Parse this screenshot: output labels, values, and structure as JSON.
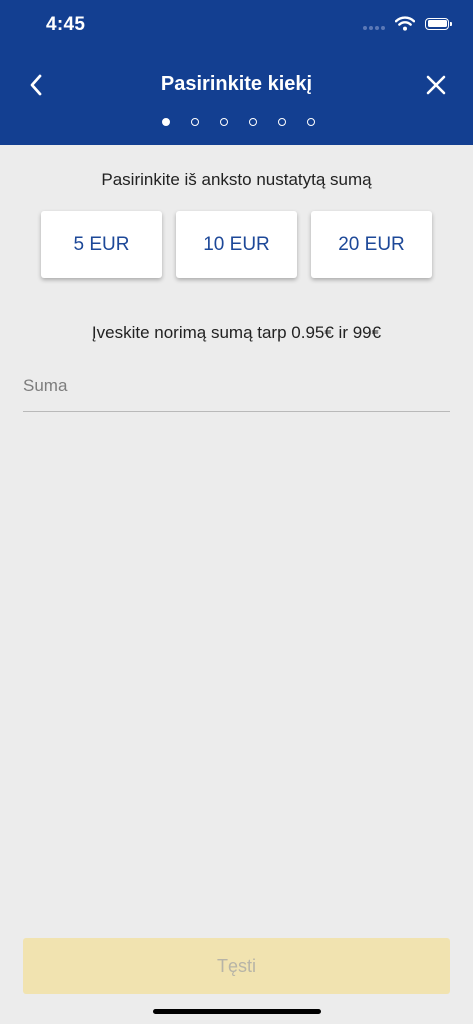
{
  "status_bar": {
    "time": "4:45",
    "icons": [
      "signal-dots-icon",
      "wifi-icon",
      "battery-icon"
    ]
  },
  "header": {
    "title": "Pasirinkite kiekį",
    "back_icon": "chevron-left-icon",
    "close_icon": "close-icon",
    "step_total": 6,
    "step_current": 1
  },
  "presets": {
    "heading": "Pasirinkite iš anksto nustatytą sumą",
    "options": [
      "5 EUR",
      "10 EUR",
      "20 EUR"
    ]
  },
  "amount": {
    "hint": "Įveskite norimą sumą tarp 0.95€ ir 99€",
    "placeholder": "Suma",
    "value": ""
  },
  "footer": {
    "continue_label": "Tęsti",
    "continue_enabled": false
  },
  "colors": {
    "header_bg": "#133f91",
    "accent_text": "#1d4898",
    "page_bg": "#ececec",
    "disabled_button_bg": "#f1e3b0",
    "disabled_button_text": "#b7b4a7"
  }
}
